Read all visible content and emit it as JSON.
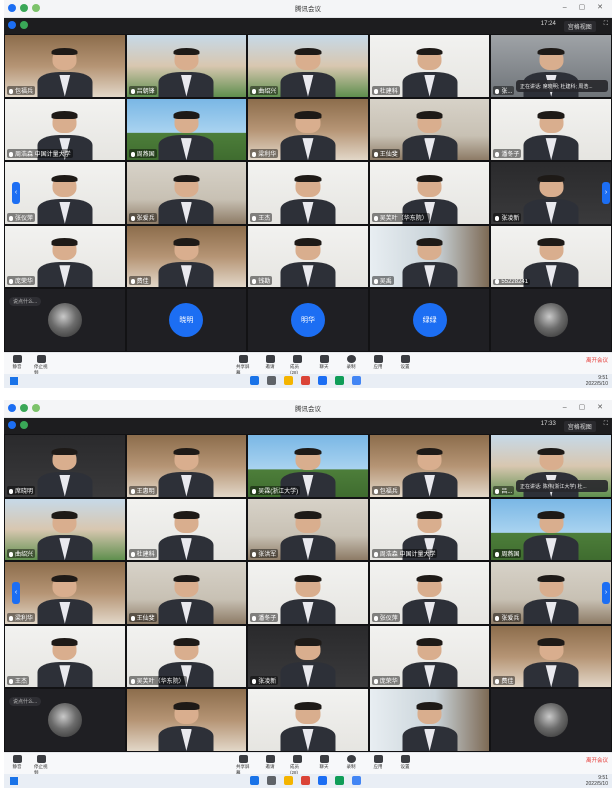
{
  "app_title": "腾讯会议",
  "toolbar_buttons": [
    "静音",
    "停止视频",
    "共享屏幕",
    "邀请",
    "成员(28)",
    "聊天",
    "录制",
    "应用",
    "设置"
  ],
  "leave_label": "离开会议",
  "chat_placeholder": "说点什么...",
  "colors": {
    "accent": "#1c6ef3",
    "leave": "#e53935",
    "meeting_bg": "#121214"
  },
  "screenshots": [
    {
      "time": "17:24",
      "view_label": "宫格视图",
      "speaker_popup": "正在讲话: 席晓明; 杜建科; 周浩...",
      "tray_time": "9:51",
      "tray_date": "2022/5/10",
      "tiles": [
        {
          "name": "包福兵",
          "bg": "shelf"
        },
        {
          "name": "吕朝锋",
          "bg": "campus"
        },
        {
          "name": "曲绍兴",
          "bg": "campus"
        },
        {
          "name": "杜建科",
          "bg": "white"
        },
        {
          "name": "张...",
          "bg": "grey"
        },
        {
          "name": "周浩森 中国计量大学",
          "bg": "white"
        },
        {
          "name": "周燕国",
          "bg": "sky"
        },
        {
          "name": "梁利华",
          "bg": "shelf"
        },
        {
          "name": "王仙斐",
          "bg": "office"
        },
        {
          "name": "潘冬子",
          "bg": "white"
        },
        {
          "name": "张仪萍",
          "bg": "white"
        },
        {
          "name": "张爱兵",
          "bg": "office"
        },
        {
          "name": "王杰",
          "bg": "white"
        },
        {
          "name": "吴芙叶（华东院）",
          "bg": "white"
        },
        {
          "name": "张凌新",
          "bg": "dark"
        },
        {
          "name": "庞荣华",
          "bg": "white"
        },
        {
          "name": "费佳",
          "bg": "shelf"
        },
        {
          "name": "钱勘",
          "bg": "white"
        },
        {
          "name": "吴禹",
          "bg": "window"
        },
        {
          "name": "55228241",
          "bg": "white"
        }
      ],
      "bottom_row": [
        {
          "type": "photo",
          "name": ""
        },
        {
          "type": "avatar",
          "name": "晓明"
        },
        {
          "type": "avatar",
          "name": "明华"
        },
        {
          "type": "avatar",
          "name": "绿绿"
        },
        {
          "type": "photo",
          "name": ""
        }
      ]
    },
    {
      "time": "17:33",
      "view_label": "宫格视图",
      "speaker_popup": "正在讲话: 陈伟(浙江大学) 杜...",
      "tray_time": "9:51",
      "tray_date": "2022/5/10",
      "tiles": [
        {
          "name": "席晓明",
          "bg": "dark"
        },
        {
          "name": "王惠明",
          "bg": "shelf"
        },
        {
          "name": "吴霖(浙江大学)",
          "bg": "sky"
        },
        {
          "name": "包福兵",
          "bg": "shelf"
        },
        {
          "name": "吕...",
          "bg": "campus"
        },
        {
          "name": "曲绍兴",
          "bg": "campus"
        },
        {
          "name": "杜建科",
          "bg": "white"
        },
        {
          "name": "张洪军",
          "bg": "office"
        },
        {
          "name": "周浩森 中国计量大学",
          "bg": "white"
        },
        {
          "name": "周燕国",
          "bg": "sky"
        },
        {
          "name": "梁利华",
          "bg": "shelf"
        },
        {
          "name": "王仙斐",
          "bg": "office"
        },
        {
          "name": "潘冬子",
          "bg": "white"
        },
        {
          "name": "张仪萍",
          "bg": "white"
        },
        {
          "name": "张爱兵",
          "bg": "office"
        },
        {
          "name": "王杰",
          "bg": "white"
        },
        {
          "name": "吴芙叶（华东院）",
          "bg": "white"
        },
        {
          "name": "张凌新",
          "bg": "dark"
        },
        {
          "name": "庞荣华",
          "bg": "white"
        },
        {
          "name": "费佳",
          "bg": "shelf"
        }
      ],
      "bottom_row": [
        {
          "type": "photo",
          "name": ""
        },
        {
          "type": "tile",
          "name": "",
          "bg": "shelf"
        },
        {
          "type": "tile",
          "name": "",
          "bg": "white"
        },
        {
          "type": "tile",
          "name": "",
          "bg": "window"
        },
        {
          "type": "photo",
          "name": ""
        }
      ]
    }
  ]
}
